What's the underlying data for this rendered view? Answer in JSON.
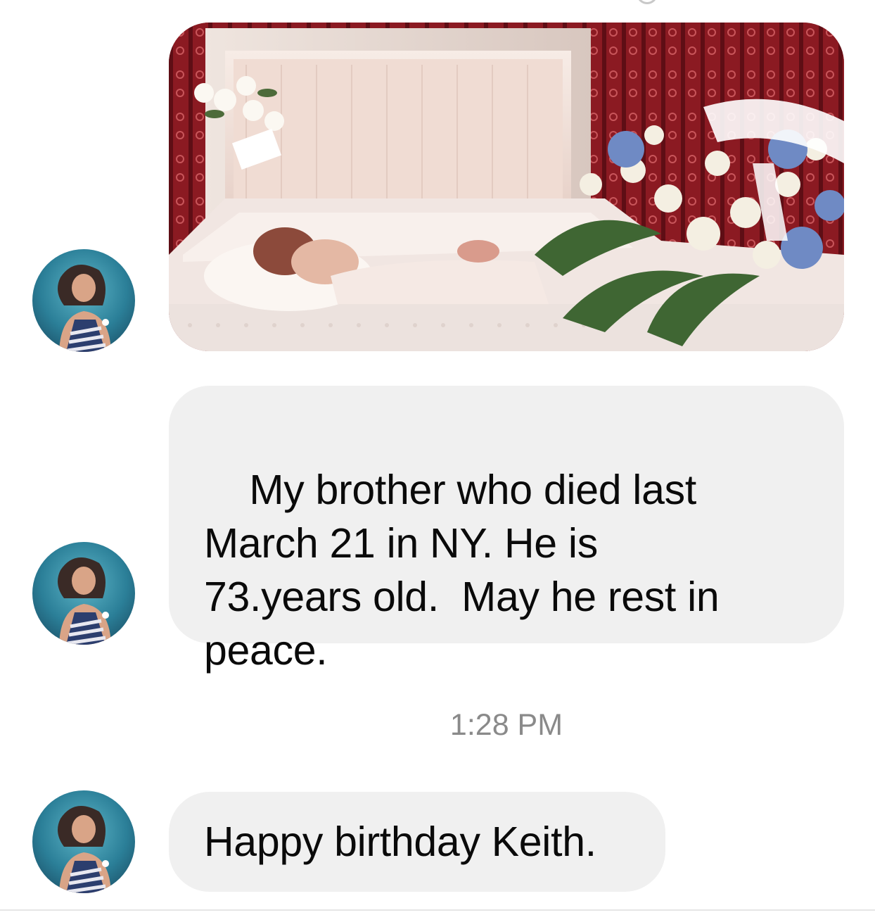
{
  "conversation": {
    "messages": [
      {
        "type": "photo",
        "sender_avatar": "profile-photo"
      },
      {
        "type": "text",
        "text": "My brother who died last\nMarch 21 in NY. He is\n73.years old.  May he rest in\npeace.",
        "sender_avatar": "profile-photo"
      },
      {
        "type": "timestamp",
        "text": "1:28 PM"
      },
      {
        "type": "text",
        "text": "Happy birthday Keith.",
        "sender_avatar": "profile-photo"
      }
    ]
  },
  "colors": {
    "bubble_background": "#f0f0f0",
    "text": "#0a0a0a",
    "timestamp": "#8a8a8a",
    "background": "#ffffff"
  }
}
